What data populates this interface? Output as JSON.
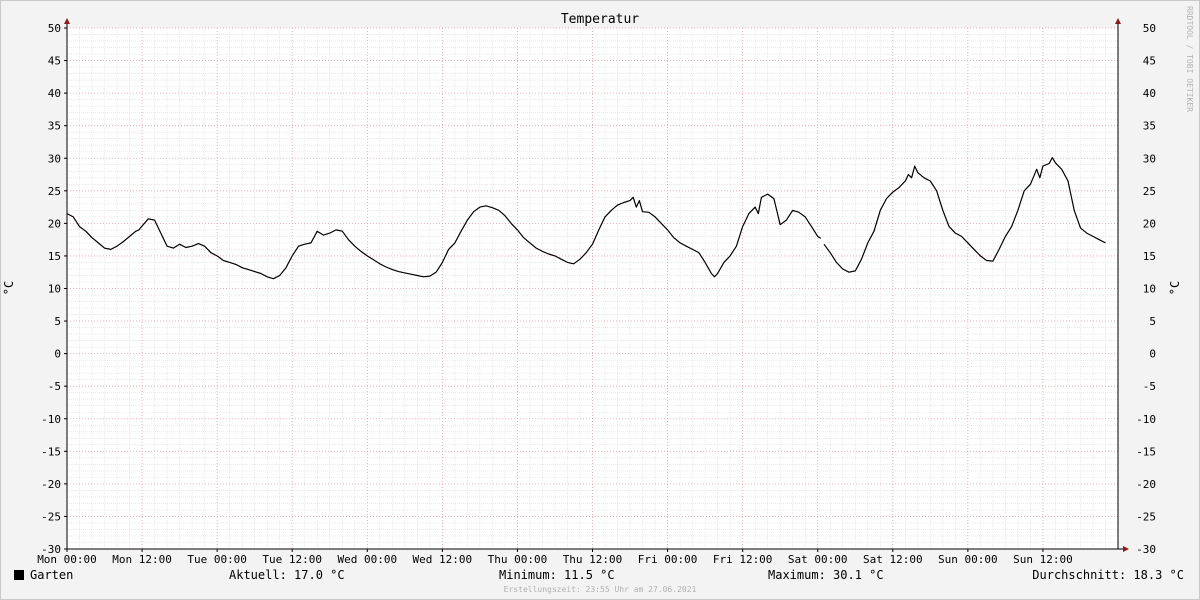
{
  "chart_data": {
    "type": "line",
    "title": "Temperatur",
    "ylabel": "°C",
    "ylim": [
      -30,
      50
    ],
    "y_ticks": [
      50,
      45,
      40,
      35,
      30,
      25,
      20,
      15,
      10,
      5,
      0,
      -5,
      -10,
      -15,
      -20,
      -25,
      -30
    ],
    "x_range_hours": [
      0,
      168
    ],
    "x_ticks": [
      {
        "hour": 0,
        "label": "Mon 00:00"
      },
      {
        "hour": 12,
        "label": "Mon 12:00"
      },
      {
        "hour": 24,
        "label": "Tue 00:00"
      },
      {
        "hour": 36,
        "label": "Tue 12:00"
      },
      {
        "hour": 48,
        "label": "Wed 00:00"
      },
      {
        "hour": 60,
        "label": "Wed 12:00"
      },
      {
        "hour": 72,
        "label": "Thu 00:00"
      },
      {
        "hour": 84,
        "label": "Thu 12:00"
      },
      {
        "hour": 96,
        "label": "Fri 00:00"
      },
      {
        "hour": 108,
        "label": "Fri 12:00"
      },
      {
        "hour": 120,
        "label": "Sat 00:00"
      },
      {
        "hour": 132,
        "label": "Sat 12:00"
      },
      {
        "hour": 144,
        "label": "Sun 00:00"
      },
      {
        "hour": 156,
        "label": "Sun 12:00"
      }
    ],
    "grid": true,
    "series": [
      {
        "name": "Garten",
        "color": "#000000",
        "segments": [
          [
            [
              0,
              21.5
            ],
            [
              1,
              21
            ],
            [
              2,
              19.5
            ],
            [
              3,
              18.8
            ],
            [
              4,
              17.8
            ],
            [
              5,
              17
            ],
            [
              6,
              16.2
            ],
            [
              7,
              16
            ],
            [
              8,
              16.5
            ],
            [
              9,
              17.2
            ],
            [
              10,
              18
            ],
            [
              11,
              18.8
            ],
            [
              11.5,
              19
            ],
            [
              12,
              19.6
            ],
            [
              13,
              20.7
            ],
            [
              14,
              20.5
            ],
            [
              15,
              18.5
            ],
            [
              16,
              16.5
            ],
            [
              17,
              16.2
            ],
            [
              18,
              16.8
            ],
            [
              19,
              16.3
            ],
            [
              20,
              16.5
            ],
            [
              21,
              16.9
            ],
            [
              22,
              16.5
            ],
            [
              23,
              15.5
            ],
            [
              24,
              15
            ],
            [
              25,
              14.3
            ],
            [
              26,
              14
            ],
            [
              27,
              13.7
            ],
            [
              28,
              13.2
            ],
            [
              29,
              12.9
            ],
            [
              30,
              12.6
            ],
            [
              31,
              12.3
            ],
            [
              32,
              11.8
            ],
            [
              33,
              11.5
            ],
            [
              34,
              12
            ],
            [
              35,
              13.2
            ],
            [
              36,
              15
            ],
            [
              37,
              16.5
            ],
            [
              38,
              16.8
            ],
            [
              39,
              17
            ],
            [
              40,
              18.8
            ],
            [
              41,
              18.2
            ],
            [
              42,
              18.5
            ],
            [
              43,
              19
            ],
            [
              44,
              18.8
            ],
            [
              45,
              17.5
            ],
            [
              46,
              16.5
            ],
            [
              47,
              15.7
            ],
            [
              48,
              15
            ],
            [
              49,
              14.4
            ],
            [
              50,
              13.8
            ],
            [
              51,
              13.3
            ],
            [
              52,
              12.9
            ],
            [
              53,
              12.6
            ],
            [
              54,
              12.4
            ],
            [
              55,
              12.2
            ],
            [
              56,
              12
            ],
            [
              57,
              11.8
            ],
            [
              58,
              11.9
            ],
            [
              59,
              12.5
            ],
            [
              60,
              14
            ],
            [
              61,
              16
            ],
            [
              62,
              17
            ],
            [
              63,
              18.8
            ],
            [
              64,
              20.5
            ],
            [
              65,
              21.8
            ],
            [
              66,
              22.5
            ],
            [
              67,
              22.7
            ],
            [
              68,
              22.4
            ],
            [
              69,
              22
            ],
            [
              70,
              21.2
            ],
            [
              71,
              20
            ],
            [
              72,
              19
            ],
            [
              73,
              17.8
            ],
            [
              74,
              17
            ],
            [
              75,
              16.2
            ],
            [
              76,
              15.7
            ],
            [
              77,
              15.3
            ],
            [
              78,
              15
            ],
            [
              79,
              14.5
            ],
            [
              80,
              14
            ],
            [
              81,
              13.8
            ],
            [
              82,
              14.5
            ],
            [
              83,
              15.5
            ],
            [
              84,
              16.8
            ],
            [
              85,
              19
            ],
            [
              86,
              21
            ],
            [
              87,
              22
            ],
            [
              88,
              22.8
            ],
            [
              89,
              23.2
            ],
            [
              90,
              23.5
            ],
            [
              90.5,
              24
            ],
            [
              91,
              22.5
            ],
            [
              91.5,
              23.5
            ],
            [
              92,
              21.8
            ],
            [
              93,
              21.7
            ],
            [
              94,
              21
            ],
            [
              95,
              20
            ],
            [
              96,
              19
            ],
            [
              97,
              17.8
            ],
            [
              98,
              17
            ],
            [
              99,
              16.5
            ],
            [
              100,
              16
            ],
            [
              101,
              15.5
            ],
            [
              102,
              14
            ],
            [
              103,
              12.3
            ],
            [
              103.5,
              11.8
            ],
            [
              104,
              12.3
            ],
            [
              105,
              14
            ],
            [
              106,
              15
            ],
            [
              107,
              16.5
            ],
            [
              108,
              19.5
            ],
            [
              109,
              21.5
            ],
            [
              110,
              22.5
            ],
            [
              110.5,
              21.5
            ],
            [
              111,
              24
            ],
            [
              112,
              24.5
            ],
            [
              113,
              23.8
            ],
            [
              114,
              19.8
            ],
            [
              115,
              20.5
            ],
            [
              116,
              22
            ],
            [
              117,
              21.7
            ],
            [
              118,
              21
            ],
            [
              119,
              19.5
            ],
            [
              120,
              18
            ],
            [
              120.5,
              17.7
            ]
          ],
          [
            [
              121,
              16.8
            ],
            [
              122,
              15.5
            ],
            [
              123,
              14
            ],
            [
              124,
              13
            ],
            [
              125,
              12.5
            ],
            [
              126,
              12.7
            ],
            [
              127,
              14.5
            ],
            [
              128,
              17
            ],
            [
              129,
              18.8
            ],
            [
              130,
              22
            ],
            [
              131,
              23.8
            ],
            [
              132,
              24.8
            ],
            [
              133,
              25.5
            ],
            [
              134,
              26.5
            ],
            [
              134.5,
              27.5
            ],
            [
              135,
              27
            ],
            [
              135.5,
              28.8
            ],
            [
              136,
              27.8
            ],
            [
              137,
              27
            ],
            [
              138,
              26.5
            ],
            [
              139,
              25
            ],
            [
              140,
              22
            ],
            [
              141,
              19.5
            ],
            [
              142,
              18.5
            ],
            [
              143,
              18
            ],
            [
              144,
              17
            ],
            [
              145,
              16
            ],
            [
              146,
              15
            ],
            [
              147,
              14.3
            ],
            [
              148,
              14.2
            ],
            [
              149,
              16
            ],
            [
              150,
              18
            ],
            [
              151,
              19.5
            ],
            [
              152,
              22
            ],
            [
              153,
              25
            ],
            [
              154,
              26
            ],
            [
              155,
              28.3
            ],
            [
              155.5,
              27
            ],
            [
              156,
              28.8
            ],
            [
              157,
              29.2
            ],
            [
              157.5,
              30.1
            ],
            [
              158,
              29.3
            ],
            [
              159,
              28.3
            ],
            [
              160,
              26.5
            ],
            [
              161,
              22
            ],
            [
              162,
              19.3
            ],
            [
              163,
              18.5
            ],
            [
              164,
              18
            ],
            [
              165,
              17.5
            ],
            [
              166,
              17
            ]
          ]
        ]
      }
    ]
  },
  "watermark": "RRDTOOL / TOBI OETIKER",
  "legend": {
    "series_name": "Garten",
    "aktuell": "Aktuell: 17.0 °C",
    "minimum": "Minimum: 11.5 °C",
    "maximum": "Maximum: 30.1 °C",
    "durchschnitt": "Durchschnitt: 18.3 °C"
  },
  "footer": "Erstellungszeit: 23:55 Uhr am 27.06.2021",
  "colors": {
    "background": "#f3f3f3",
    "plot_background": "#ffffff",
    "major_grid": "#e0a0a8",
    "minor_grid": "#dcdcdc",
    "axis_arrow": "#8b1a1a",
    "line": "#000000"
  }
}
